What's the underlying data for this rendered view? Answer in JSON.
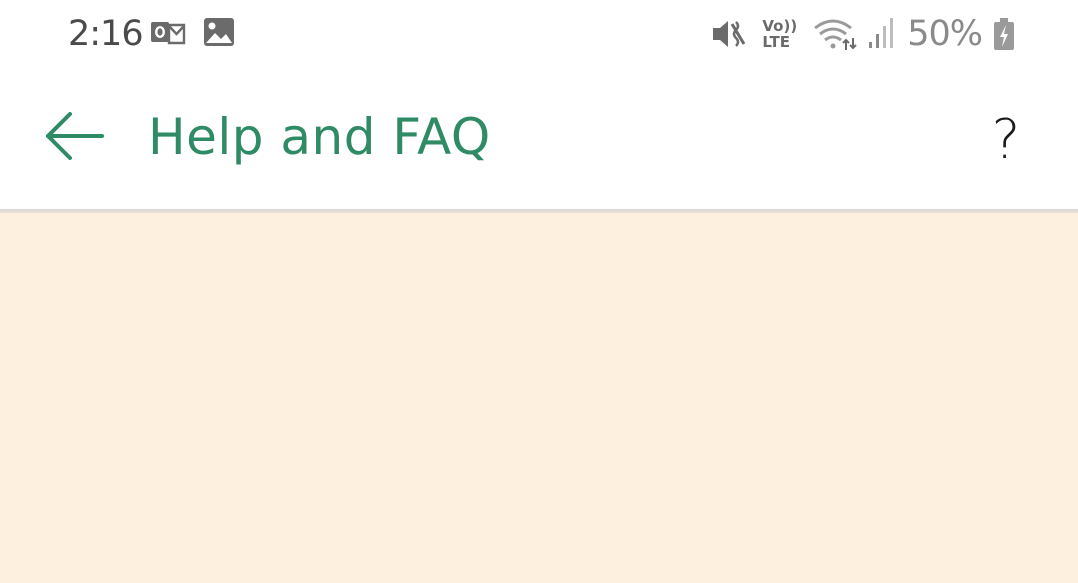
{
  "status_bar": {
    "time": "2:16",
    "left_icons": [
      "outlook-icon",
      "image-icon"
    ],
    "right_icons": [
      "mute-icon",
      "volte-icon",
      "wifi-icon",
      "signal-icon",
      "battery-charging-icon"
    ],
    "volte_top": "Vo))",
    "volte_bottom": "LTE",
    "battery_percent": "50%"
  },
  "app_bar": {
    "title": "Help and FAQ",
    "back_icon": "arrow-left-icon",
    "help_label": "?"
  },
  "colors": {
    "accent": "#2e8b63",
    "content_background": "#fef0df",
    "status_text": "#4a4a4a",
    "status_icon": "#8a8a8a"
  }
}
